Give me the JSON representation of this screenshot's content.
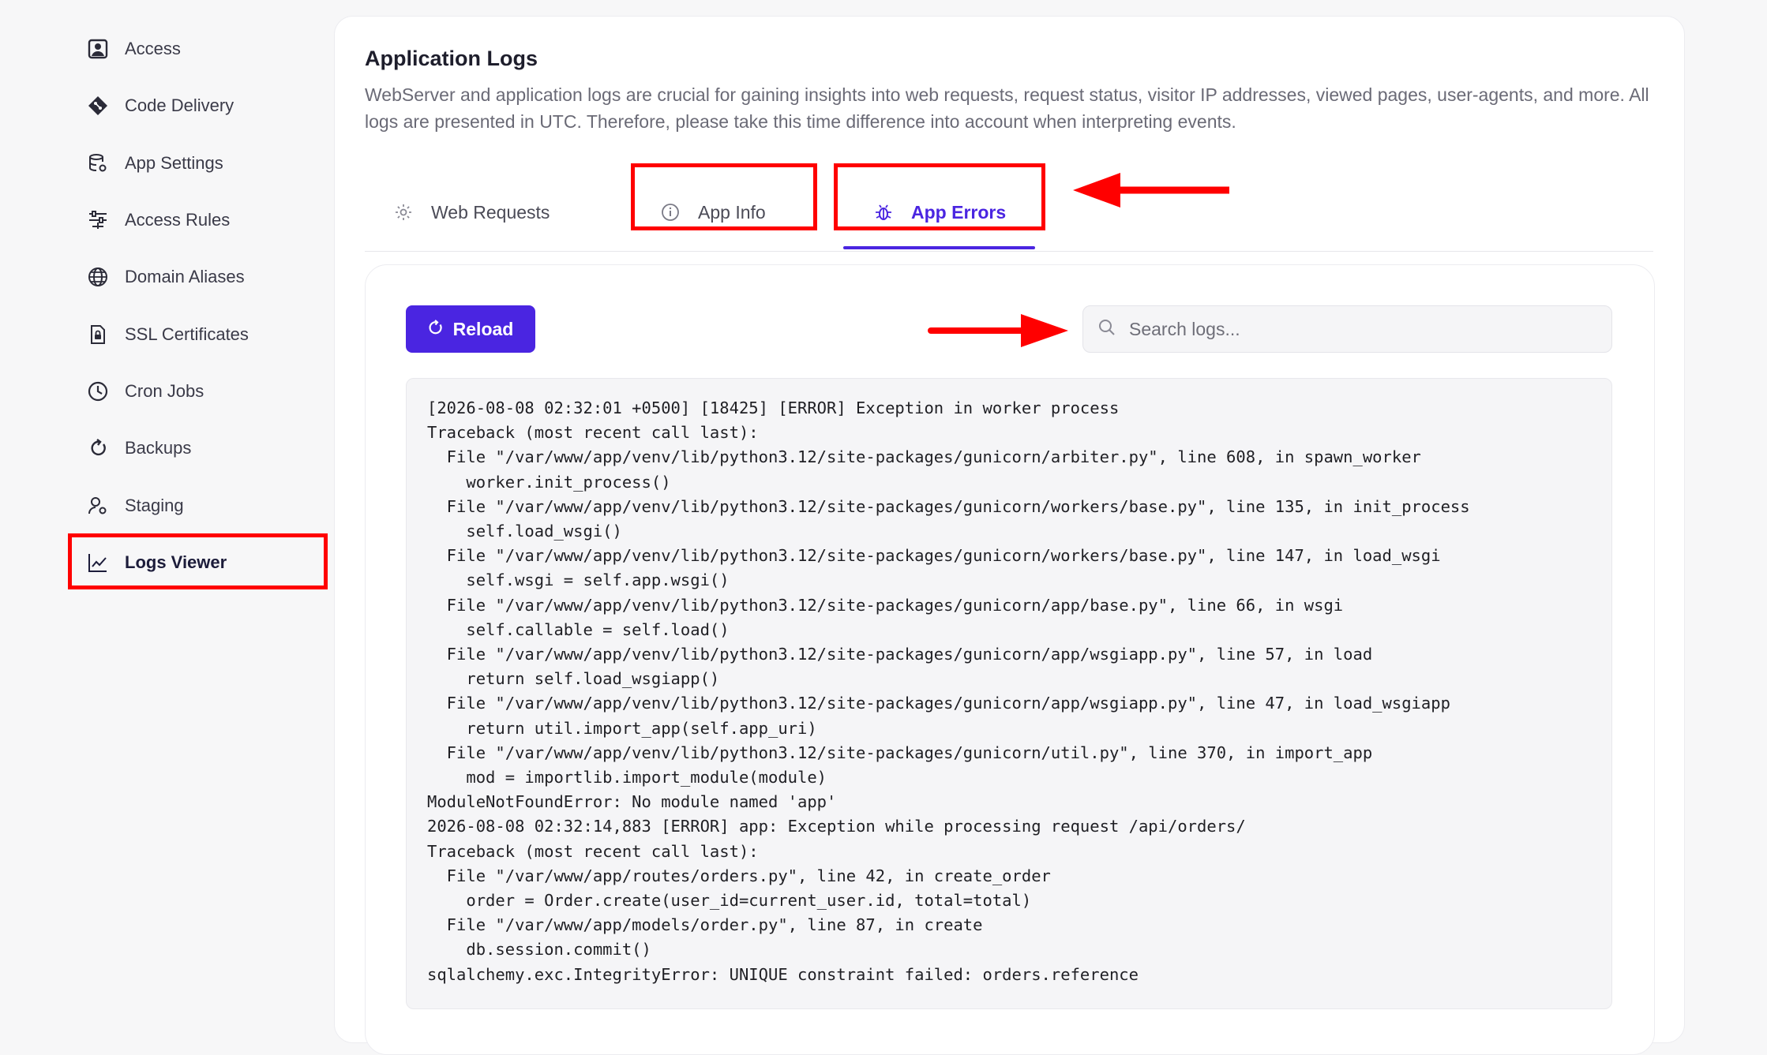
{
  "sidebar": {
    "items": [
      {
        "label": "Access",
        "icon": "user-card-icon"
      },
      {
        "label": "Code Delivery",
        "icon": "git-diamond-icon"
      },
      {
        "label": "App Settings",
        "icon": "database-settings-icon"
      },
      {
        "label": "Access Rules",
        "icon": "filter-sliders-icon"
      },
      {
        "label": "Domain Aliases",
        "icon": "globe-icon"
      },
      {
        "label": "SSL Certificates",
        "icon": "lock-file-icon"
      },
      {
        "label": "Cron Jobs",
        "icon": "clock-icon"
      },
      {
        "label": "Backups",
        "icon": "refresh-icon"
      },
      {
        "label": "Staging",
        "icon": "user-gear-icon"
      },
      {
        "label": "Logs Viewer",
        "icon": "line-chart-icon",
        "active": true
      }
    ]
  },
  "page": {
    "title": "Application Logs",
    "description": "WebServer and application logs are crucial for gaining insights into web requests, request status, visitor IP addresses, viewed pages, user-agents, and more. All logs are presented in UTC. Therefore, please take this time difference into account when interpreting events."
  },
  "tabs": [
    {
      "label": "Web Requests",
      "icon": "gear-icon"
    },
    {
      "label": "App Info",
      "icon": "info-circle-icon"
    },
    {
      "label": "App Errors",
      "icon": "bug-icon",
      "active": true
    }
  ],
  "toolbar": {
    "reload_label": "Reload",
    "search_placeholder": "Search logs..."
  },
  "logs": {
    "lines": [
      "[2026-08-08 02:32:01 +0500] [18425] [ERROR] Exception in worker process",
      "Traceback (most recent call last):",
      "  File \"/var/www/app/venv/lib/python3.12/site-packages/gunicorn/arbiter.py\", line 608, in spawn_worker",
      "    worker.init_process()",
      "  File \"/var/www/app/venv/lib/python3.12/site-packages/gunicorn/workers/base.py\", line 135, in init_process",
      "    self.load_wsgi()",
      "  File \"/var/www/app/venv/lib/python3.12/site-packages/gunicorn/workers/base.py\", line 147, in load_wsgi",
      "    self.wsgi = self.app.wsgi()",
      "  File \"/var/www/app/venv/lib/python3.12/site-packages/gunicorn/app/base.py\", line 66, in wsgi",
      "    self.callable = self.load()",
      "  File \"/var/www/app/venv/lib/python3.12/site-packages/gunicorn/app/wsgiapp.py\", line 57, in load",
      "    return self.load_wsgiapp()",
      "  File \"/var/www/app/venv/lib/python3.12/site-packages/gunicorn/app/wsgiapp.py\", line 47, in load_wsgiapp",
      "    return util.import_app(self.app_uri)",
      "  File \"/var/www/app/venv/lib/python3.12/site-packages/gunicorn/util.py\", line 370, in import_app",
      "    mod = importlib.import_module(module)",
      "ModuleNotFoundError: No module named 'app'",
      "2026-08-08 02:32:14,883 [ERROR] app: Exception while processing request /api/orders/",
      "Traceback (most recent call last):",
      "  File \"/var/www/app/routes/orders.py\", line 42, in create_order",
      "    order = Order.create(user_id=current_user.id, total=total)",
      "  File \"/var/www/app/models/order.py\", line 87, in create",
      "    db.session.commit()",
      "sqlalchemy.exc.IntegrityError: UNIQUE constraint failed: orders.reference"
    ]
  },
  "colors": {
    "accent": "#4a25e1",
    "annotation_red": "#ff0000",
    "page_bg": "#f7f7f8"
  }
}
